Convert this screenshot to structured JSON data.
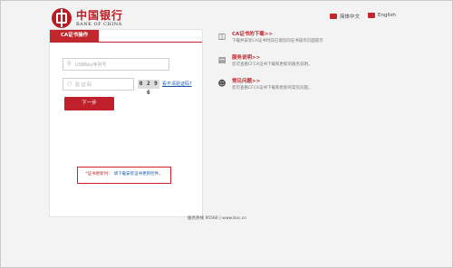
{
  "header": {
    "logo_cn": "中国银行",
    "logo_en": "BANK OF CHINA",
    "lang_cn": "简体中文",
    "lang_en": "English"
  },
  "panel": {
    "tab_label": "CA证书操作",
    "usbkey_placeholder": "USBKey序列号",
    "code_placeholder": "验 证 码",
    "captcha_value": "0 2 9 6",
    "refresh_link": "看不清验证码?",
    "next_button": "下一步",
    "notice_red": "*证书更新时：",
    "notice_blue": "请下载安装证书更新控件。"
  },
  "items": [
    {
      "title": "CA证书的下载>>",
      "desc": "下载并安装CA证书时前已请您的证书操作页面提示",
      "icon": "download-icon"
    },
    {
      "title": "服务说明>>",
      "desc": "您可查看CFCA证书下载和更新的服务说明。",
      "icon": "document-icon"
    },
    {
      "title": "常见问题>>",
      "desc": "您可查看CFCA证书下载和更新的常见问题。",
      "icon": "support-icon"
    }
  ],
  "footer": {
    "hotline_label": "服务热线",
    "hotline": "95566",
    "separator": "|",
    "website": "www.boc.cn"
  },
  "colors": {
    "accent": "#c1272d",
    "link": "#1a56a8"
  }
}
